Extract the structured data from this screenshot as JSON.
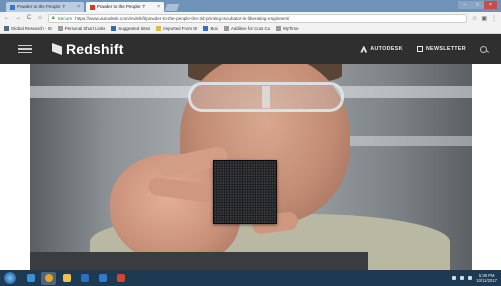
{
  "browser": {
    "tabs": [
      {
        "label": "Powder to the People: T",
        "close": "×",
        "active": false
      },
      {
        "label": "Powder to the People: T",
        "close": "×",
        "active": true
      }
    ],
    "window_controls": {
      "minimize": "–",
      "maximize": "□",
      "close": "×"
    },
    "nav": {
      "back": "←",
      "forward": "→",
      "reload": "C",
      "home": "⌂"
    },
    "secure_label": "Secure",
    "url": "https://www.autodesk.com/redshift/powder-to-the-people-the-3d-printing-incubator-is-liberating-engineers/",
    "toolbar_right": {
      "star": "☆",
      "extension": "▣",
      "menu": "⋮"
    }
  },
  "bookmarks": [
    {
      "label": "Global Research - St",
      "color": "#4a6d8c"
    },
    {
      "label": "Personal Short Links",
      "color": "#9a9a9a"
    },
    {
      "label": "Suggested Sites",
      "color": "#2b6cb3"
    },
    {
      "label": "Imported From IE",
      "color": "#e1b84b"
    },
    {
      "label": "Box",
      "color": "#2a73c9"
    },
    {
      "label": "Additive for Cost Cu",
      "color": "#9a9a9a"
    },
    {
      "label": "MyTime",
      "color": "#9a9a9a"
    }
  ],
  "site": {
    "logo_text": "Redshift",
    "autodesk_label": "AUTODESK",
    "newsletter_label": "NEWSLETTER"
  },
  "taskbar": {
    "apps": [
      {
        "name": "ie",
        "color": "#3d8fd6",
        "active": false
      },
      {
        "name": "chrome",
        "color": "#e0a72c",
        "active": true
      },
      {
        "name": "explorer",
        "color": "#f0c24a",
        "active": false
      },
      {
        "name": "outlook",
        "color": "#2a6fc0",
        "active": false
      },
      {
        "name": "outlook-calendar",
        "color": "#2f7ad0",
        "active": false
      },
      {
        "name": "powerpoint",
        "color": "#d24726",
        "active": false
      }
    ],
    "time": "5:39 PM",
    "date": "10/11/2017"
  }
}
